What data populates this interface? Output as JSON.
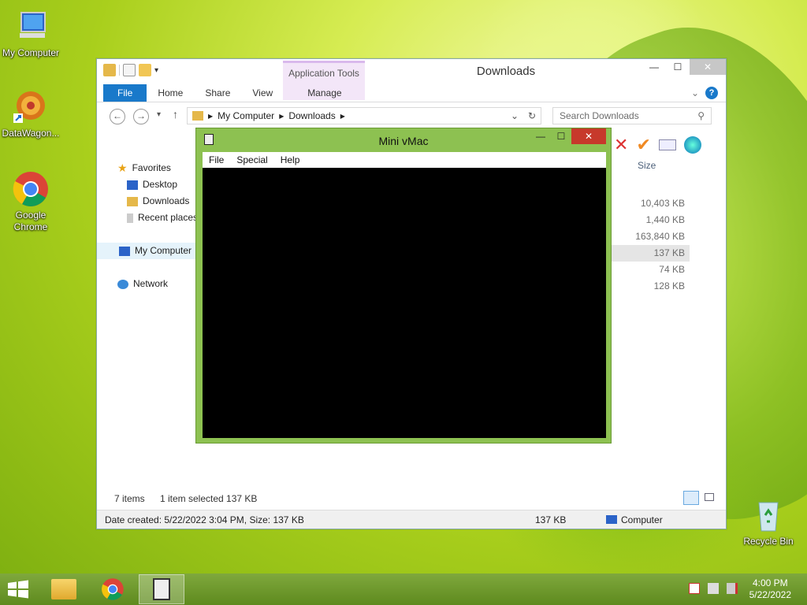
{
  "desktop": {
    "icons": [
      {
        "label": "My Computer"
      },
      {
        "label": "DataWagon..."
      },
      {
        "label": "Google Chrome"
      },
      {
        "label": "Recycle Bin"
      }
    ]
  },
  "explorer": {
    "title": "Downloads",
    "contextual_tab_group": "Application Tools",
    "tabs": [
      "File",
      "Home",
      "Share",
      "View",
      "Manage"
    ],
    "address": {
      "parts": [
        "My Computer",
        "Downloads"
      ]
    },
    "search_placeholder": "Search Downloads",
    "nav": {
      "favorites": "Favorites",
      "desktop": "Desktop",
      "downloads": "Downloads",
      "recent": "Recent places",
      "my_computer": "My Computer",
      "network": "Network"
    },
    "size_header": "Size",
    "sizes": [
      "10,403 KB",
      "1,440 KB",
      "163,840 KB",
      "137 KB",
      "74 KB",
      "128 KB"
    ],
    "selected_row_index": 3,
    "status": {
      "items": "7 items",
      "selected": "1 item selected  137 KB",
      "details": "Date created: 5/22/2022 3:04 PM, Size: 137 KB",
      "size": "137 KB",
      "location": "Computer"
    }
  },
  "minivmac": {
    "title": "Mini vMac",
    "menu": [
      "File",
      "Special",
      "Help"
    ]
  },
  "taskbar": {
    "time": "4:00 PM",
    "date": "5/22/2022"
  }
}
